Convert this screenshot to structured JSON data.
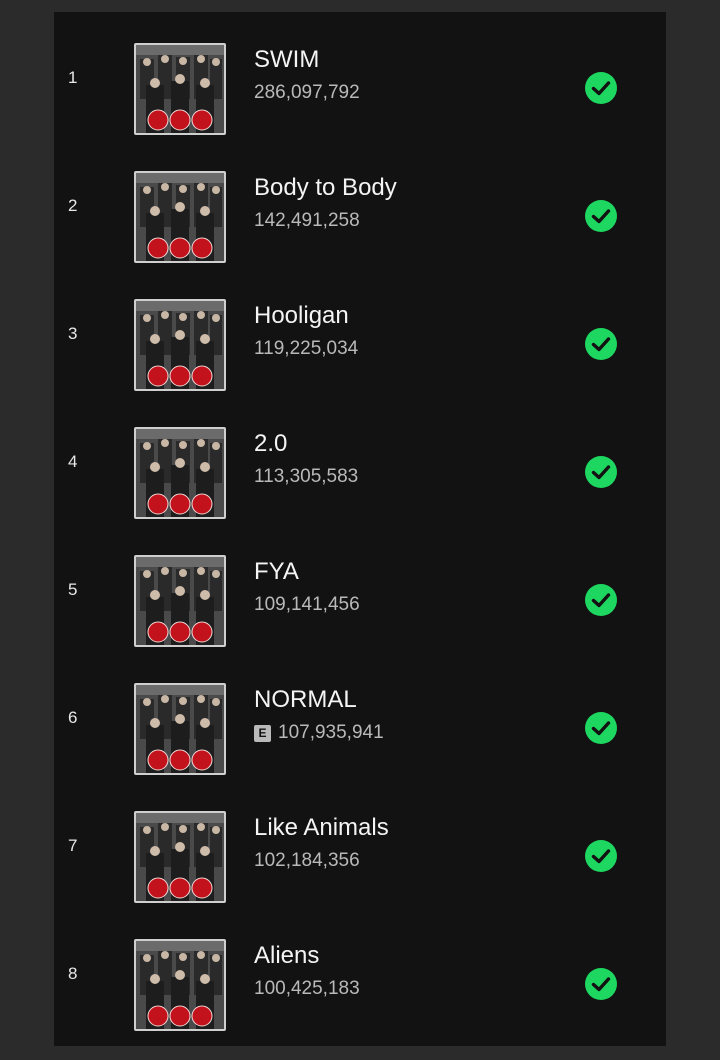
{
  "accent_color": "#1ed760",
  "tracks": [
    {
      "rank": "1",
      "title": "SWIM",
      "plays": "286,097,792",
      "explicit": false,
      "saved": true
    },
    {
      "rank": "2",
      "title": "Body to Body",
      "plays": "142,491,258",
      "explicit": false,
      "saved": true
    },
    {
      "rank": "3",
      "title": "Hooligan",
      "plays": "119,225,034",
      "explicit": false,
      "saved": true
    },
    {
      "rank": "4",
      "title": "2.0",
      "plays": "113,305,583",
      "explicit": false,
      "saved": true
    },
    {
      "rank": "5",
      "title": "FYA",
      "plays": "109,141,456",
      "explicit": false,
      "saved": true
    },
    {
      "rank": "6",
      "title": "NORMAL",
      "plays": "107,935,941",
      "explicit": true,
      "explicit_label": "E",
      "saved": true
    },
    {
      "rank": "7",
      "title": "Like Animals",
      "plays": "102,184,356",
      "explicit": false,
      "saved": true
    },
    {
      "rank": "8",
      "title": "Aliens",
      "plays": "100,425,183",
      "explicit": false,
      "saved": true
    }
  ]
}
